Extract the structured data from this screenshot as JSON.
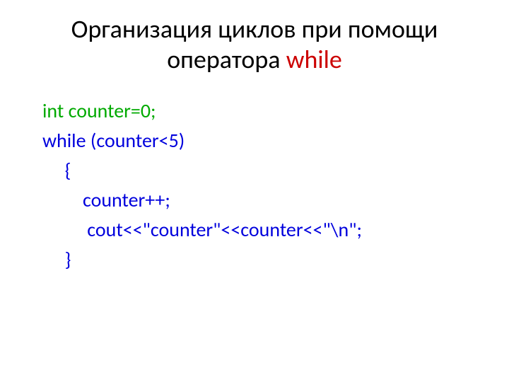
{
  "title": {
    "part1": "Организация циклов при помощи",
    "part2_prefix": "оператора ",
    "keyword": "while"
  },
  "code": {
    "line1": "int counter=0;",
    "line2": "while (counter<5)",
    "line3": "     {",
    "line4": "         counter++;",
    "line5": "          cout<<\"counter\"<<counter<<\"\\n\";",
    "line6": "     }"
  }
}
